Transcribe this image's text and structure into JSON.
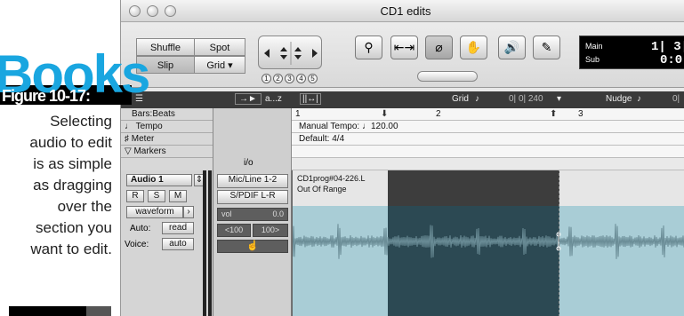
{
  "watermark": {
    "part1": "Books",
    "dot": "."
  },
  "figure": {
    "label": "Figure 10-17:",
    "caption": [
      "Selecting",
      "audio to edit",
      "is as simple",
      "as dragging",
      "over the",
      "section you",
      "want to edit."
    ]
  },
  "window": {
    "title": "CD1 edits"
  },
  "modes": {
    "shuffle": "Shuffle",
    "spot": "Spot",
    "slip": "Slip",
    "grid": "Grid"
  },
  "nudge_numbers": [
    "1",
    "2",
    "3",
    "4",
    "5"
  ],
  "counter": {
    "main_label": "Main",
    "sub_label": "Sub",
    "main_value": "1| 3|",
    "sub_value": "0:0"
  },
  "ruler": {
    "grid_label": "Grid",
    "grid_value": "0| 0| 240",
    "nudge_label": "Nudge",
    "nudge_value": "0|",
    "az": "a...z"
  },
  "rows": {
    "bars_beats": "Bars:Beats",
    "tempo": "Tempo",
    "meter": "Meter",
    "markers": "Markers",
    "io": "i/o"
  },
  "timeline": {
    "bar1": "1",
    "bar2": "2",
    "bar3": "3",
    "tempo_text": "Manual Tempo: ♩120.00",
    "meter_text": "Default: 4/4"
  },
  "track": {
    "name": "Audio 1",
    "r": "R",
    "s": "S",
    "m": "M",
    "view": "waveform",
    "auto_label": "Auto:",
    "auto_value": "read",
    "voice_label": "Voice:",
    "voice_value": "auto",
    "input": "Mic/Line 1-2",
    "output": "S/PDIF L-R",
    "vol_label": "vol",
    "vol_value": "0.0",
    "pan_l": "<100",
    "pan_r": "100>"
  },
  "clip": {
    "name": "CD1prog#04-226.L",
    "status": "Out Of Range"
  },
  "colors": {
    "waveform": "#6a8c96",
    "clip_bg": "#a9cdd6",
    "selection": "#2c4953",
    "watermark": "#19a6e0"
  }
}
